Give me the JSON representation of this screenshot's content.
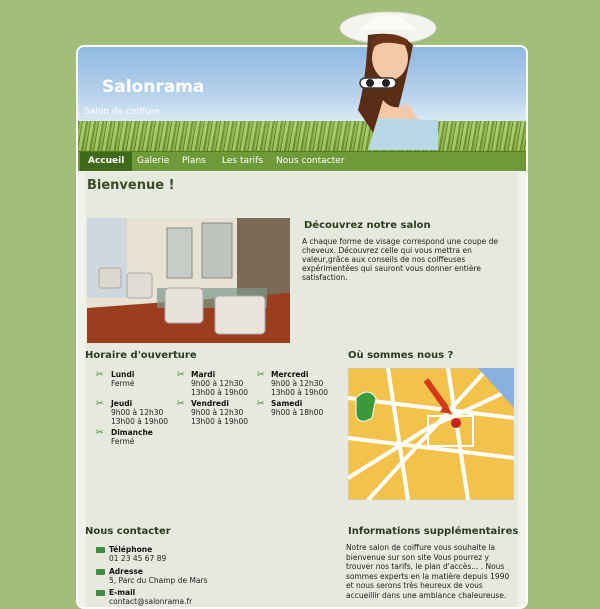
{
  "header": {
    "title": "Salonrama",
    "subtitle": "Salon de coiffure"
  },
  "nav": {
    "items": [
      "Accueil",
      "Galerie",
      "Plans",
      "Les tarifs",
      "Nous contacter"
    ]
  },
  "welcome": {
    "title": "Bienvenue !"
  },
  "discover": {
    "title": "Découvrez notre salon",
    "text": "A chaque forme de visage correspond une coupe de cheveux. Découvrez celle qui vous mettra en valeur,grâce aux conseils de nos coiffeuses expérimentées qui sauront vous donner entière satisfaction."
  },
  "hours": {
    "title": "Horaire d'ouverture",
    "days": [
      {
        "day": "Lundi",
        "l1": "Fermé",
        "l2": ""
      },
      {
        "day": "Mardi",
        "l1": "9h00 à 12h30",
        "l2": "13h00 à 19h00"
      },
      {
        "day": "Mercredi",
        "l1": "9h00 à 12h30",
        "l2": "13h00 à 19h00"
      },
      {
        "day": "Jeudi",
        "l1": "9h00 à 12h30",
        "l2": "13h00 à 19h00"
      },
      {
        "day": "Vendredi",
        "l1": "9h00 à 12h30",
        "l2": "13h00 à 19h00"
      },
      {
        "day": "Samedi",
        "l1": "9h00 à 18h00",
        "l2": ""
      },
      {
        "day": "Dimanche",
        "l1": "Fermé",
        "l2": ""
      }
    ]
  },
  "location": {
    "title": "Où sommes nous ?"
  },
  "contact": {
    "title": "Nous contacter",
    "phone_label": "Téléphone",
    "phone": "01 23 45 67 89",
    "address_label": "Adresse",
    "address": "5, Parc du Champ de Mars",
    "email_label": "E-mail",
    "email": "contact@salonrama.fr"
  },
  "info": {
    "title": "Informations supplémentaires",
    "text": "Notre salon de coiffure vous souhaite la bienvenue sur son site Vous pourrez y trouver nos tarifs, le plan d'accès... . Nous sommes experts en la matière depuis 1990 et nous serons très heureux de vous accueillir dans une ambiance chaleureuse."
  },
  "colors": {
    "background": "#a3be78",
    "nav": "#6f9a3a",
    "nav_active": "#3f6a1a",
    "accent_icon": "#3e8c3e"
  }
}
